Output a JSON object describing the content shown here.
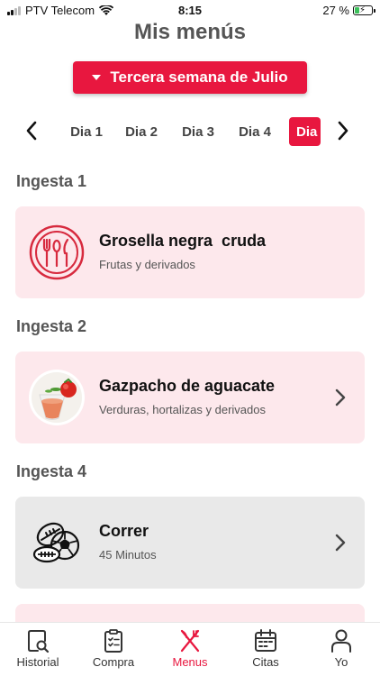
{
  "status_bar": {
    "carrier": "PTV Telecom",
    "time": "8:15",
    "battery_percent": "27 %",
    "battery_level": 0.27
  },
  "header": {
    "title": "Mis menús",
    "week_label": "Tercera semana de Julio"
  },
  "day_tabs": [
    {
      "label": "Dia 1"
    },
    {
      "label": "Dia 2"
    },
    {
      "label": "Dia 3"
    },
    {
      "label": "Dia 4"
    },
    {
      "label": "Dia",
      "active": true
    }
  ],
  "sections": [
    {
      "label": "Ingesta 1",
      "item": {
        "title": "Grosella negra  cruda",
        "subtitle": "Frutas y derivados",
        "icon": "food-utensils-icon"
      }
    },
    {
      "label": "Ingesta 2",
      "item": {
        "title": "Gazpacho de aguacate",
        "subtitle": "Verduras, hortalizas y derivados",
        "icon": "gazpacho-photo"
      }
    },
    {
      "label": "Ingesta 4",
      "item": {
        "title": "Correr",
        "subtitle": "45 Minutos",
        "icon": "sports-balls-icon"
      }
    }
  ],
  "tab_bar": [
    {
      "label": "Historial",
      "icon": "history-search-icon"
    },
    {
      "label": "Compra",
      "icon": "clipboard-list-icon"
    },
    {
      "label": "Menus",
      "icon": "fork-knife-icon",
      "active": true
    },
    {
      "label": "Citas",
      "icon": "calendar-icon"
    },
    {
      "label": "Yo",
      "icon": "user-icon"
    }
  ],
  "colors": {
    "accent": "#e8173f",
    "card_pink": "#fde8ec",
    "card_grey": "#e9e9e9"
  }
}
